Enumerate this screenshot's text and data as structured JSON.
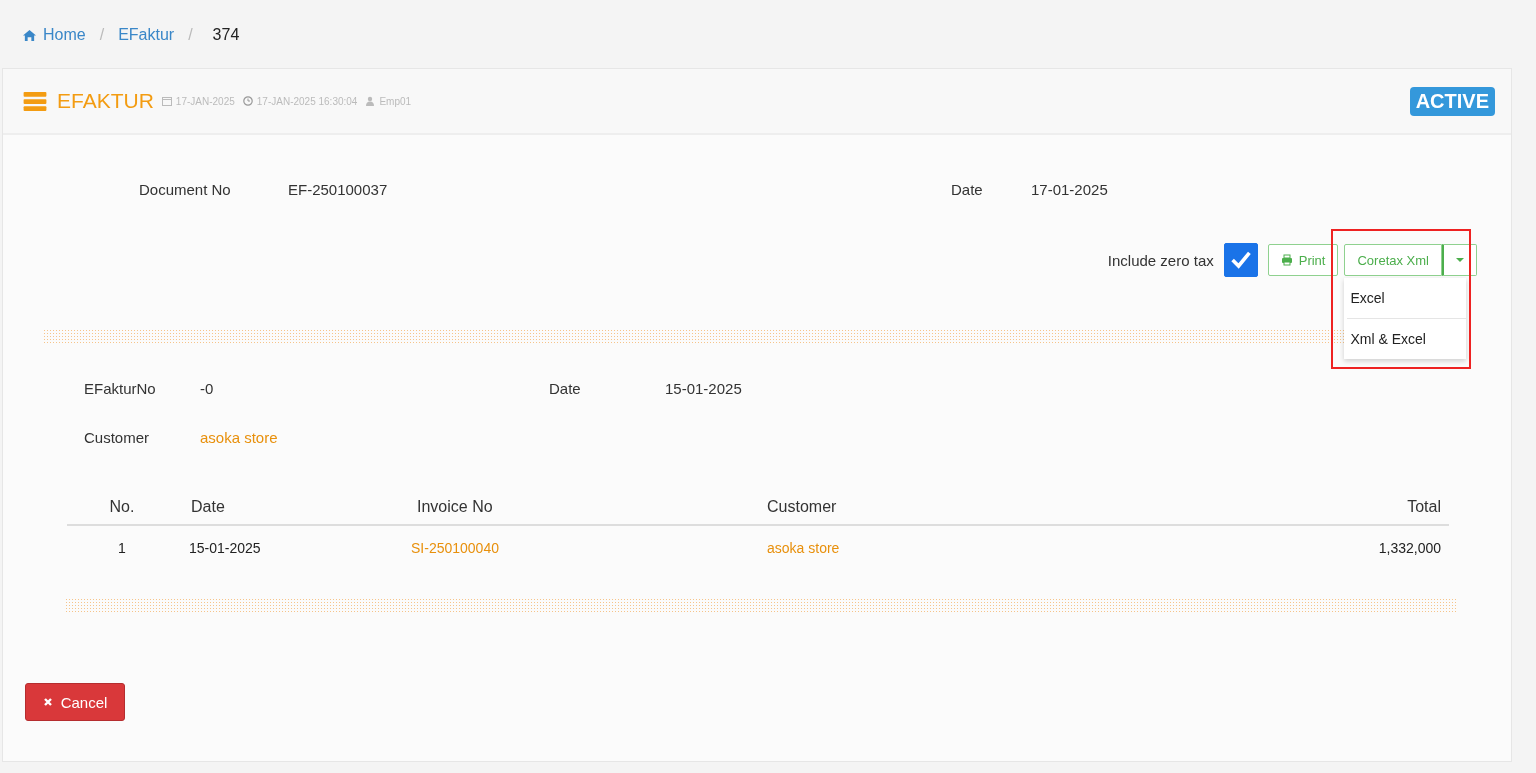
{
  "breadcrumb": [
    {
      "label": "Home",
      "link": true,
      "kind": "home"
    },
    {
      "separator": "/",
      "label": "EFaktur",
      "link": true,
      "kind": "plain"
    },
    {
      "separator": "/",
      "label": "374",
      "link": false,
      "kind": "plain"
    }
  ],
  "header": {
    "title": "EFAKTUR",
    "date": "17-JAN-2025",
    "timestamp": "17-JAN-2025 16:30:04",
    "user": "Emp01",
    "status": "ACTIVE"
  },
  "document": {
    "fields": [
      {
        "label": "Document No",
        "value": "EF-250100037"
      },
      {
        "label": "Date",
        "value": "17-01-2025"
      }
    ]
  },
  "actions": {
    "include_zero_tax": {
      "label": "Include zero tax",
      "checked": true
    },
    "print": "Print",
    "export": "Coretax Xml",
    "menu": [
      "Excel",
      "Xml & Excel"
    ]
  },
  "efaktur": {
    "fields": [
      {
        "label": "EFakturNo",
        "value": "-0",
        "link": false
      },
      {
        "label": "Date",
        "value": "15-01-2025",
        "link": false
      },
      {
        "label": "Customer",
        "value": "asoka store",
        "link": true
      }
    ]
  },
  "table": {
    "columns": [
      "No.",
      "Date",
      "Invoice No",
      "Customer",
      "Total"
    ],
    "rows": [
      [
        "1",
        "15-01-2025",
        "SI-250100040",
        "asoka store",
        "1,332,000"
      ]
    ]
  },
  "cancel": "Cancel"
}
